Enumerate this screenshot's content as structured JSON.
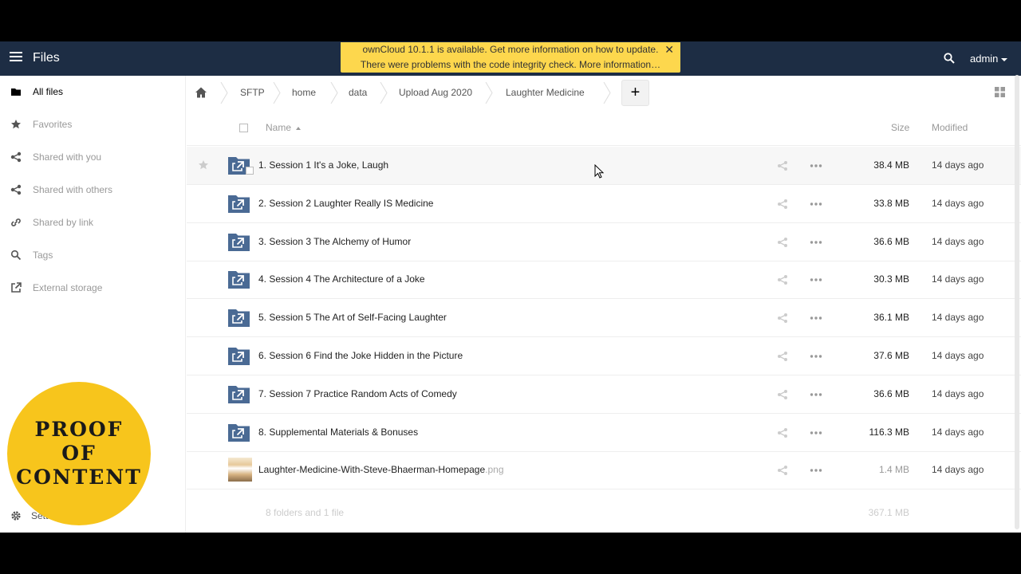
{
  "header": {
    "app_title": "Files",
    "user": "admin"
  },
  "notification": {
    "line1": "ownCloud 10.1.1 is available. Get more information on how to update.",
    "line2": "There were problems with the code integrity check. More information…",
    "close": "✕"
  },
  "sidebar": {
    "items": [
      {
        "label": "All files",
        "icon": "folder-icon"
      },
      {
        "label": "Favorites",
        "icon": "star-icon"
      },
      {
        "label": "Shared with you",
        "icon": "share-icon"
      },
      {
        "label": "Shared with others",
        "icon": "share-icon"
      },
      {
        "label": "Shared by link",
        "icon": "link-icon"
      },
      {
        "label": "Tags",
        "icon": "tag-search-icon"
      },
      {
        "label": "External storage",
        "icon": "external-link-icon"
      }
    ],
    "settings_label": "Sett"
  },
  "badge": {
    "line1": "PROOF",
    "line2": "OF",
    "line3": "CONTENT"
  },
  "breadcrumb": {
    "crumbs": [
      "SFTP",
      "home",
      "data",
      "Upload Aug 2020",
      "Laughter Medicine"
    ],
    "new_label": "+"
  },
  "list": {
    "col_name": "Name",
    "col_size": "Size",
    "col_modified": "Modified",
    "rows": [
      {
        "name": "1. Session 1 It's a Joke, Laugh",
        "ext": "",
        "size": "38.4 MB",
        "modified": "14 days ago",
        "type": "folder"
      },
      {
        "name": "2. Session 2 Laughter Really IS Medicine",
        "ext": "",
        "size": "33.8 MB",
        "modified": "14 days ago",
        "type": "folder"
      },
      {
        "name": "3. Session 3 The Alchemy of Humor",
        "ext": "",
        "size": "36.6 MB",
        "modified": "14 days ago",
        "type": "folder"
      },
      {
        "name": "4. Session 4 The Architecture of a Joke",
        "ext": "",
        "size": "30.3 MB",
        "modified": "14 days ago",
        "type": "folder"
      },
      {
        "name": "5. Session 5 The Art of Self-Facing Laughter",
        "ext": "",
        "size": "36.1 MB",
        "modified": "14 days ago",
        "type": "folder"
      },
      {
        "name": "6. Session 6 Find the Joke Hidden in the Picture",
        "ext": "",
        "size": "37.6 MB",
        "modified": "14 days ago",
        "type": "folder"
      },
      {
        "name": "7. Session 7 Practice Random Acts of Comedy",
        "ext": "",
        "size": "36.6 MB",
        "modified": "14 days ago",
        "type": "folder"
      },
      {
        "name": "8. Supplemental Materials & Bonuses",
        "ext": "",
        "size": "116.3 MB",
        "modified": "14 days ago",
        "type": "folder"
      },
      {
        "name": "Laughter-Medicine-With-Steve-Bhaerman-Homepage",
        "ext": ".png",
        "size": "1.4 MB",
        "modified": "14 days ago",
        "type": "image"
      }
    ],
    "summary_count": "8 folders and 1 file",
    "summary_total": "367.1 MB"
  },
  "colors": {
    "header_bg": "#1d2d44",
    "notification_bg": "#fdd74d",
    "folder_icon": "#4a6a94",
    "badge": "#f7c51c"
  }
}
